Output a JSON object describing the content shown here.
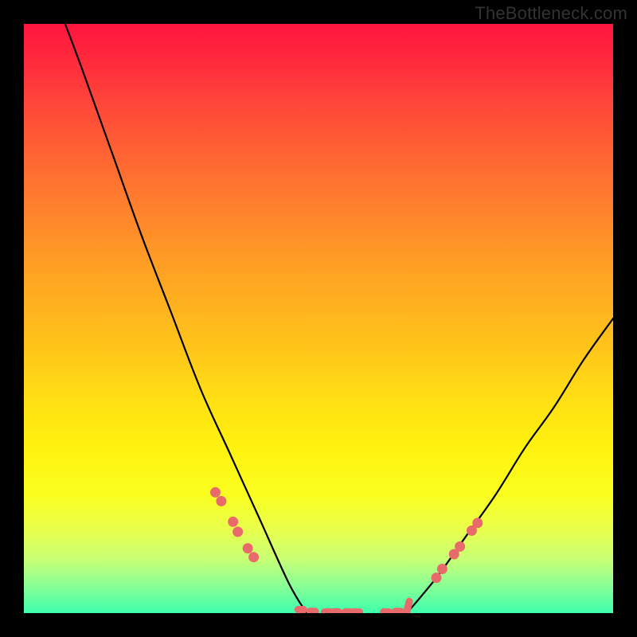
{
  "watermark": "TheBottleneck.com",
  "colors": {
    "page_bg": "#000000",
    "watermark_text": "#333333",
    "curve_stroke": "#000000",
    "marker_fill": "#e96a6a",
    "gradient_top": "#ff153f",
    "gradient_bottom": "#3effad"
  },
  "chart_data": {
    "type": "line",
    "title": "",
    "xlabel": "",
    "ylabel": "",
    "xlim": [
      0,
      100
    ],
    "ylim": [
      0,
      100
    ],
    "grid": false,
    "description": "V-shaped bottleneck curve over vertical rainbow gradient; minimum (zero bottleneck) region near x≈48–65, left branch reaches y≈100 at x≈7, right branch reaches y≈50 at x≈100.",
    "series": [
      {
        "name": "bottleneck-curve-left",
        "x": [
          7,
          10,
          15,
          20,
          25,
          30,
          35,
          40,
          45,
          48
        ],
        "y": [
          100,
          92,
          78,
          64,
          51,
          38,
          27,
          16,
          5,
          0
        ]
      },
      {
        "name": "bottleneck-curve-right",
        "x": [
          65,
          70,
          75,
          80,
          85,
          90,
          95,
          100
        ],
        "y": [
          0,
          6,
          13,
          20,
          28,
          35,
          43,
          50
        ]
      }
    ],
    "markers_left": [
      {
        "x": 32.5,
        "y": 20.5
      },
      {
        "x": 33.5,
        "y": 19.0
      },
      {
        "x": 35.5,
        "y": 15.5
      },
      {
        "x": 36.3,
        "y": 13.8
      },
      {
        "x": 38.0,
        "y": 11.0
      },
      {
        "x": 39.0,
        "y": 9.5
      }
    ],
    "markers_bottom": [
      {
        "x": 47.0,
        "y": 0.6
      },
      {
        "x": 49.0,
        "y": 0.3
      },
      {
        "x": 51.5,
        "y": 0.2
      },
      {
        "x": 53.0,
        "y": 0.2
      },
      {
        "x": 55.0,
        "y": 0.2
      },
      {
        "x": 56.5,
        "y": 0.2
      },
      {
        "x": 61.5,
        "y": 0.2
      },
      {
        "x": 63.5,
        "y": 0.3
      }
    ],
    "hook_end": {
      "x": 65.0,
      "y0": 0.3,
      "y1": 2.0
    },
    "markers_right": [
      {
        "x": 70.0,
        "y": 6.0
      },
      {
        "x": 71.0,
        "y": 7.5
      },
      {
        "x": 73.0,
        "y": 10.0
      },
      {
        "x": 74.0,
        "y": 11.3
      },
      {
        "x": 76.0,
        "y": 14.0
      },
      {
        "x": 77.0,
        "y": 15.3
      }
    ]
  }
}
